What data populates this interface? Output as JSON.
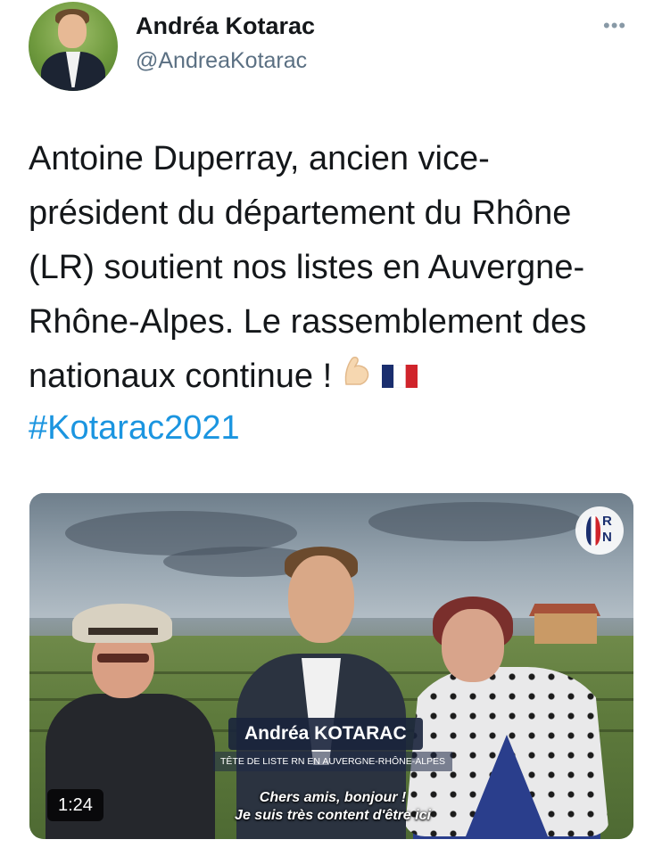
{
  "tweet": {
    "author_name": "Andréa Kotarac",
    "author_handle": "@AndreaKotarac",
    "more_icon": "ellipsis-icon",
    "text_lines": [
      "Antoine Duperray, ancien vice-",
      "président du département du Rhône",
      "(LR) soutient nos listes en Auvergne-",
      "Rhône-Alpes. Le rassemblement des",
      "nationaux continue !"
    ],
    "emojis": [
      "💪🏻",
      "🇫🇷"
    ],
    "hashtag": "#Kotarac2021"
  },
  "video": {
    "lower_third_name": "Andréa KOTARAC",
    "lower_third_title": "TÊTE DE LISTE RN EN AUVERGNE-RHÔNE-ALPES",
    "subtitle_lines": [
      "Chers amis, bonjour !",
      "Je suis très content d'être ici"
    ],
    "duration": "1:24",
    "logo_text_line1": "R",
    "logo_text_line2": "N",
    "colors": {
      "flag_blue": "#1a2e6e",
      "flag_red": "#d0242b"
    }
  },
  "colors": {
    "link": "#1b95e0",
    "secondary": "#5b7083",
    "text": "#14171a"
  }
}
